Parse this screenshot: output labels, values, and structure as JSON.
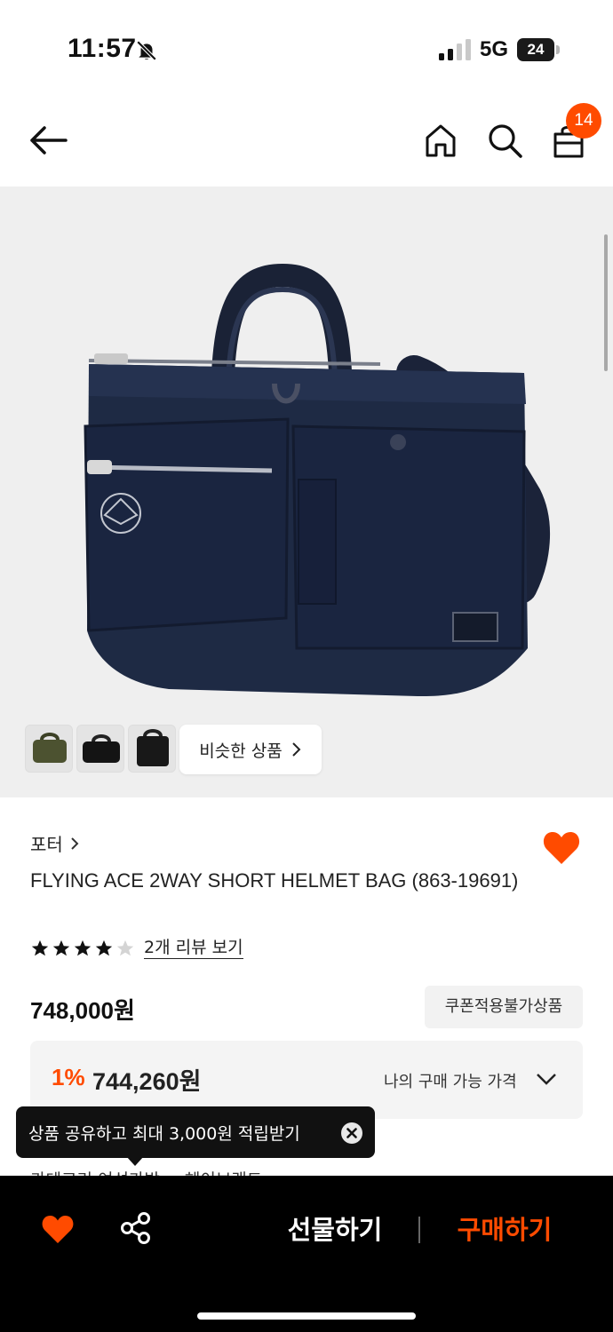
{
  "status_bar": {
    "time": "11:57",
    "network": "5G",
    "battery": "24"
  },
  "header": {
    "cart_count": "14"
  },
  "gallery": {
    "similar_label": "비슷한 상품",
    "thumbnail_count": 3
  },
  "product": {
    "brand": "포터",
    "title": "FLYING ACE 2WAY SHORT HELMET BAG (863-19691)",
    "rating": 4,
    "review_link": "2개 리뷰 보기",
    "price": "748,000원",
    "coupon_badge": "쿠폰적용불가상품",
    "discount_rate": "1%",
    "discount_price": "744,260원",
    "my_price_label": "나의 구매 가능 가격",
    "category_peek": "카테고리    여성가방  >  헤이브랜드"
  },
  "tooltip": {
    "text": "상품 공유하고 최대 3,000원 적립받기"
  },
  "bottom_bar": {
    "gift_label": "선물하기",
    "buy_label": "구매하기"
  },
  "colors": {
    "accent": "#ff4b00",
    "navy_bag": "#1e2a44",
    "image_bg": "#efefef"
  }
}
